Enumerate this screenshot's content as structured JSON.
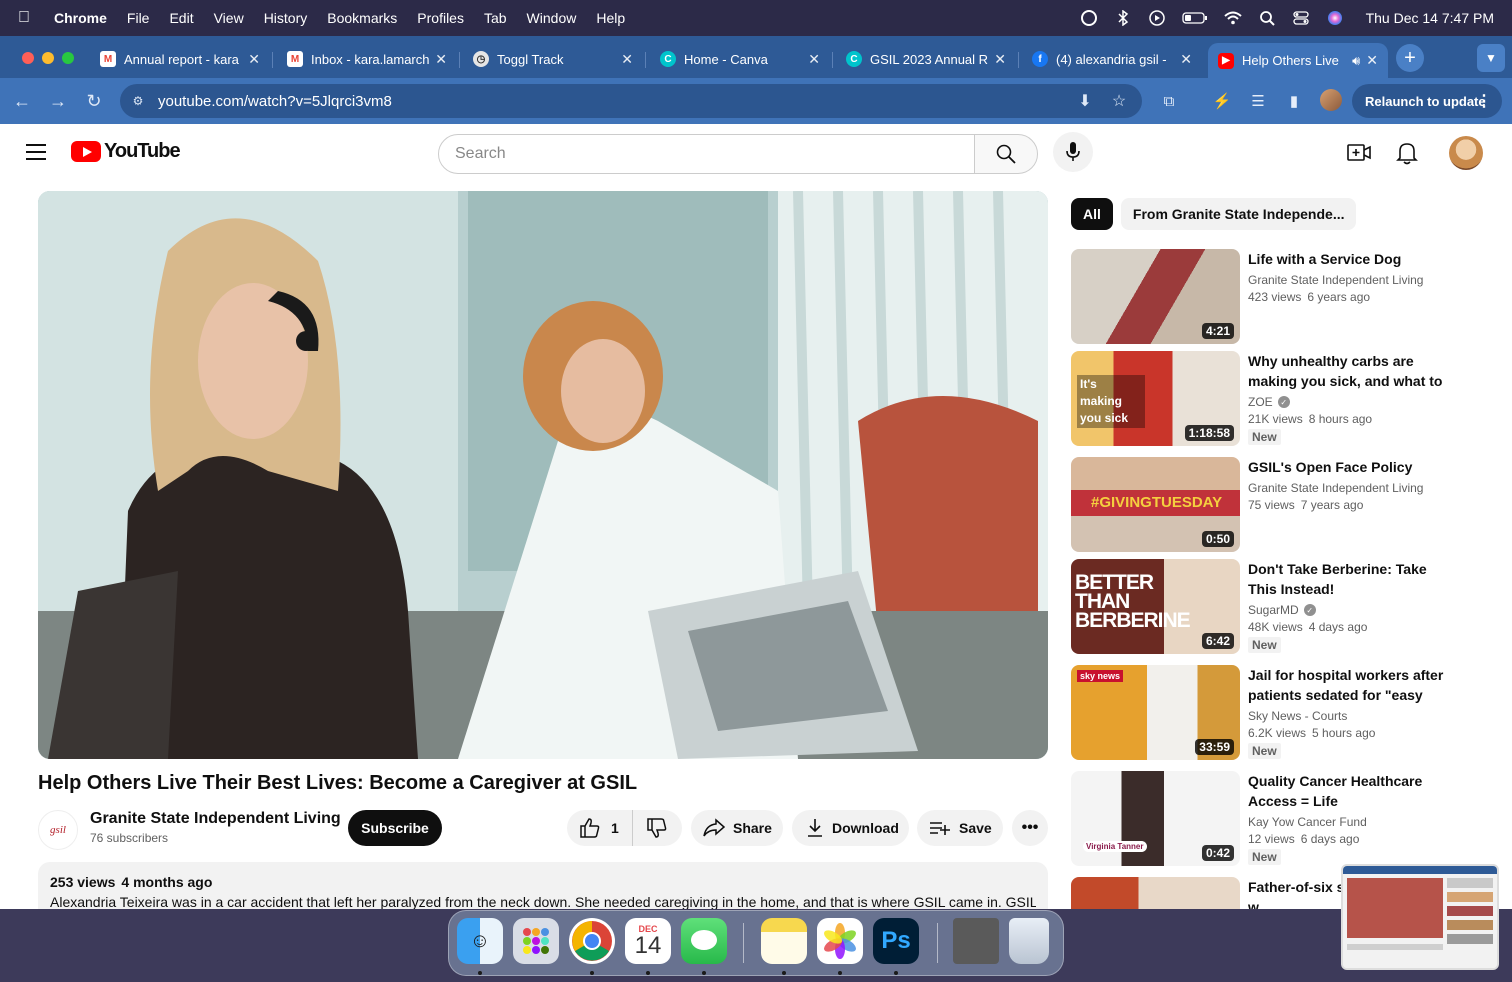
{
  "menubar": {
    "app": "Chrome",
    "items": [
      "File",
      "Edit",
      "View",
      "History",
      "Bookmarks",
      "Profiles",
      "Tab",
      "Window",
      "Help"
    ],
    "clock": "Thu Dec 14  7:47 PM"
  },
  "tabs": [
    {
      "title": "Annual report - kara",
      "icon": "gmail-icon",
      "color": "#ea4335"
    },
    {
      "title": "Inbox - kara.lamarch",
      "icon": "gmail-icon",
      "color": "#ea4335"
    },
    {
      "title": "Toggl Track",
      "icon": "toggl-icon",
      "color": "#e5e5e5"
    },
    {
      "title": "Home - Canva",
      "icon": "canva-icon",
      "color": "#00c4cc"
    },
    {
      "title": "GSIL 2023 Annual R",
      "icon": "canva-icon",
      "color": "#00c4cc"
    },
    {
      "title": "(4) alexandria gsil -",
      "icon": "facebook-icon",
      "color": "#1877f2"
    },
    {
      "title": "Help Others Live",
      "icon": "youtube-icon",
      "color": "#ff0000"
    }
  ],
  "toolbar": {
    "url": "youtube.com/watch?v=5Jlqrci3vm8",
    "relaunch_label": "Relaunch to update"
  },
  "youtube": {
    "logo_text": "YouTube",
    "search_placeholder": "Search"
  },
  "video": {
    "title": "Help Others Live Their Best Lives: Become a Caregiver at GSIL",
    "channel": "Granite State Independent Living",
    "channel_logo_text": "gsil",
    "subscribers": "76 subscribers",
    "subscribe_label": "Subscribe",
    "likes": "1",
    "share_label": "Share",
    "download_label": "Download",
    "save_label": "Save",
    "views": "253 views",
    "age": "4 months ago",
    "description": "Alexandria Teixeira was in a car accident that left her paralyzed from the neck down. She needed caregiving in the home, and that is where GSIL came in. GSIL"
  },
  "sidebar": {
    "chips": [
      "All",
      "From Granite State Independe..."
    ],
    "recommendations": [
      {
        "title": "Life with a Service Dog",
        "channel": "Granite State Independent Living",
        "views": "423 views",
        "age": "6 years ago",
        "duration": "4:21",
        "verified": false,
        "new": "",
        "thumb_text": ""
      },
      {
        "title": "Why unhealthy carbs are making you sick, and what to ...",
        "channel": "ZOE",
        "views": "21K views",
        "age": "8 hours ago",
        "duration": "1:18:58",
        "verified": true,
        "new": "New",
        "thumb_text": "It's making you sick"
      },
      {
        "title": "GSIL's Open Face Policy",
        "channel": "Granite State Independent Living",
        "views": "75 views",
        "age": "7 years ago",
        "duration": "0:50",
        "verified": false,
        "new": "",
        "thumb_text": "#GIVINGTUESDAY"
      },
      {
        "title": "Don't Take Berberine: Take This Instead!",
        "channel": "SugarMD",
        "views": "48K views",
        "age": "4 days ago",
        "duration": "6:42",
        "verified": true,
        "new": "New",
        "thumb_text": "BETTER THAN BERBERINE"
      },
      {
        "title": "Jail for hospital workers after patients sedated for \"easy shift\"",
        "channel": "Sky News - Courts",
        "views": "6.2K views",
        "age": "5 hours ago",
        "duration": "33:59",
        "verified": false,
        "new": "New",
        "thumb_text": "sky news"
      },
      {
        "title": "Quality Cancer Healthcare Access = Life",
        "channel": "Kay Yow Cancer Fund",
        "views": "12 views",
        "age": "6 days ago",
        "duration": "0:42",
        "verified": false,
        "new": "New",
        "thumb_text": "Virginia Tanner"
      },
      {
        "title": "Father-of-six st... ends meet as w...",
        "channel": "",
        "views": "",
        "age": "",
        "duration": "",
        "verified": false,
        "new": "",
        "thumb_text": ""
      }
    ]
  },
  "dock": {
    "calendar_month": "DEC",
    "calendar_day": "14",
    "ps_label": "Ps"
  }
}
